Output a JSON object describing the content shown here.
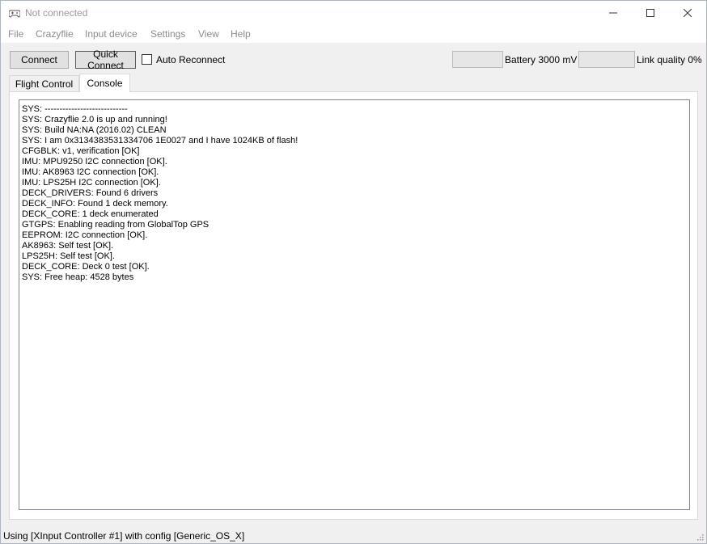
{
  "window": {
    "title": "Not connected"
  },
  "menu": [
    "File",
    "Crazyflie",
    "Input device",
    "Settings",
    "View",
    "Help"
  ],
  "toolbar": {
    "connect_label": "Connect",
    "quick_connect_label": "Quick Connect",
    "auto_reconnect_label": "Auto Reconnect",
    "auto_reconnect_checked": false,
    "battery_label": "Battery 3000 mV",
    "link_quality_label": "Link quality 0%"
  },
  "tabs": [
    {
      "label": "Flight Control",
      "active": false
    },
    {
      "label": "Console",
      "active": true
    }
  ],
  "console": {
    "lines": [
      "SYS: ----------------------------",
      "SYS: Crazyflie 2.0 is up and running!",
      "SYS: Build NA:NA (2016.02) CLEAN",
      "SYS: I am 0x3134383531334706 1E0027 and I have 1024KB of flash!",
      "CFGBLK: v1, verification [OK]",
      "IMU: MPU9250 I2C connection [OK].",
      "IMU: AK8963 I2C connection [OK].",
      "IMU: LPS25H I2C connection [OK].",
      "DECK_DRIVERS: Found 6 drivers",
      "DECK_INFO: Found 1 deck memory.",
      "DECK_CORE: 1 deck enumerated",
      "GTGPS: Enabling reading from GlobalTop GPS",
      "EEPROM: I2C connection [OK].",
      "AK8963: Self test [OK].",
      "LPS25H: Self test [OK].",
      "DECK_CORE: Deck 0 test [OK].",
      "SYS: Free heap: 4528 bytes"
    ]
  },
  "status": {
    "text": "Using [XInput Controller #1] with config [Generic_OS_X]"
  }
}
